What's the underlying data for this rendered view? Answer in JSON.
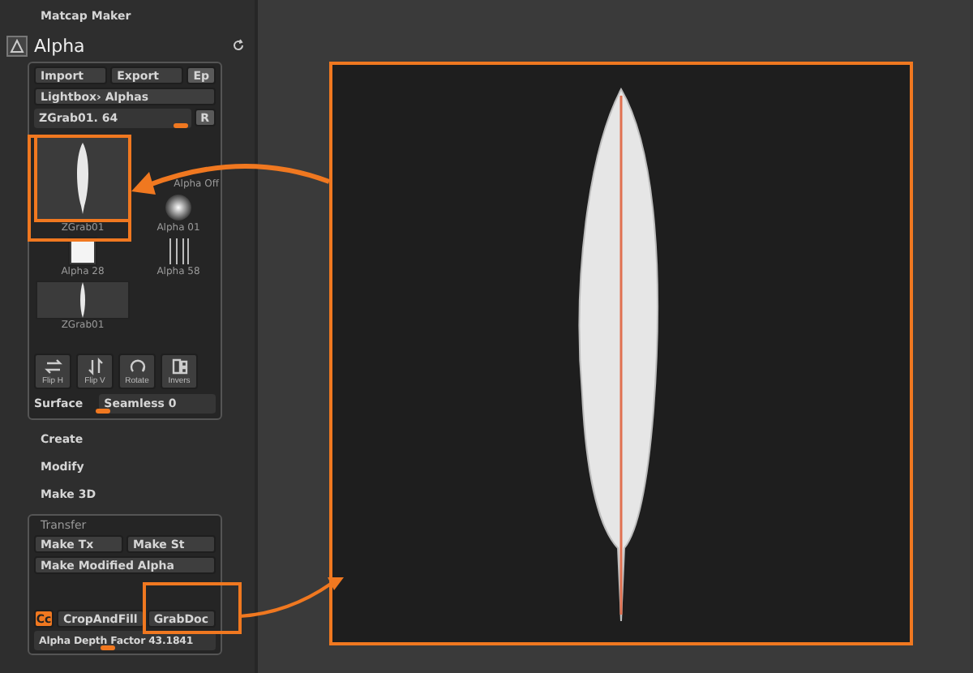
{
  "panel": {
    "top_items": [
      "Matcap Maker"
    ],
    "title": "Alpha",
    "buttons": [
      {
        "label": "Import",
        "kind": "wide"
      },
      {
        "label": "Export",
        "kind": "wide"
      },
      {
        "label": "Ep",
        "kind": "small"
      }
    ],
    "lightbox": "Lightbox› Alphas",
    "current": {
      "label": "ZGrab01. 64",
      "level": 0.95,
      "button": "R"
    },
    "alpha_off": "Alpha Off",
    "thumbnails": [
      {
        "label": "ZGrab01",
        "kind": "feather",
        "selected": true
      },
      {
        "label": "Alpha 01",
        "kind": "glow",
        "selected": false
      },
      {
        "label": "Alpha 28",
        "kind": "square",
        "selected": false
      },
      {
        "label": "Alpha 58",
        "kind": "stripes",
        "selected": false
      },
      {
        "label": "ZGrab01",
        "kind": "wide",
        "selected": false
      }
    ],
    "tools": [
      {
        "label": "Flip H",
        "kind": "fliph"
      },
      {
        "label": "Flip V",
        "kind": "flipv"
      },
      {
        "label": "Rotate",
        "kind": "rotate"
      },
      {
        "label": "Invers",
        "kind": "invert"
      }
    ],
    "surface": "Surface",
    "seamless": {
      "label": "Seamless 0",
      "level": 0
    }
  },
  "menu": [
    "Create",
    "Modify",
    "Make 3D"
  ],
  "transfer": {
    "title": "Transfer",
    "buttons": [
      "Make Tx",
      "Make St"
    ],
    "wide_button": "Make Modified Alpha",
    "cc": "Cc",
    "crop": "CropAndFill",
    "grab": "GrabDoc",
    "depth": {
      "label": "Alpha Depth Factor 43.1841",
      "level": 0.4
    }
  }
}
